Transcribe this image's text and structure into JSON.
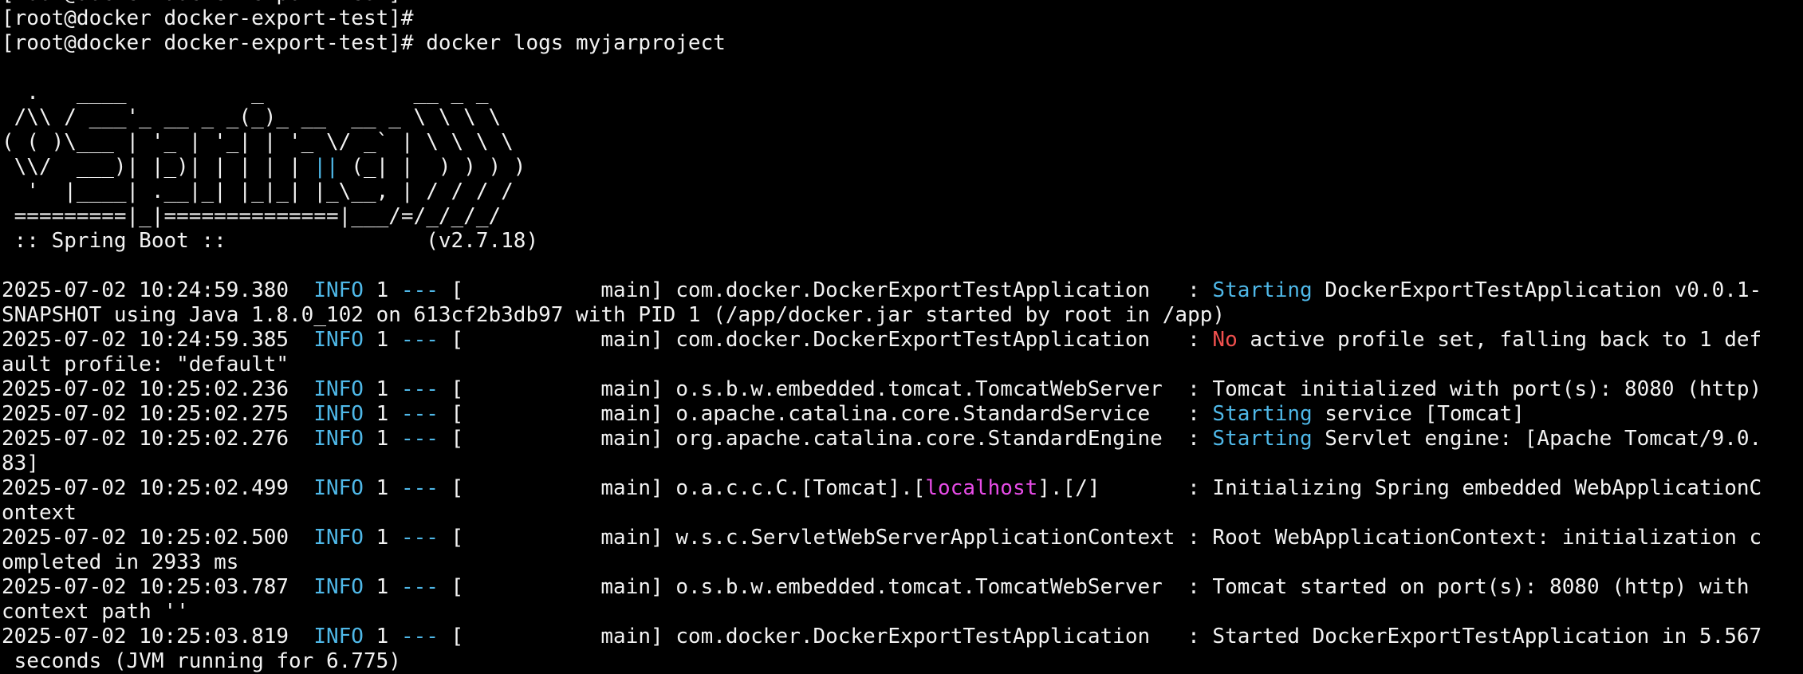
{
  "terminal": {
    "background": "#000000",
    "foreground": "#f2f2f2",
    "colors": {
      "white": "#f2f2f2",
      "blue": "#4fb8e8",
      "red": "#f0504e",
      "magenta": "#e84ce8"
    },
    "lines": [
      [
        {
          "t": "[root@docker docker-export-test]#",
          "c": "white"
        }
      ],
      [
        {
          "t": "[root@docker docker-export-test]#",
          "c": "white"
        }
      ],
      [
        {
          "t": "[root@docker docker-export-test]# docker logs myjarproject",
          "c": "white"
        }
      ],
      [
        {
          "t": "",
          "c": "white"
        }
      ],
      [
        {
          "t": "  .   ____          _            __ _ _",
          "c": "white"
        }
      ],
      [
        {
          "t": " /\\\\ / ___'_ __ _ _(_)_ __  __ _ \\ \\ \\ \\",
          "c": "white"
        }
      ],
      [
        {
          "t": "( ( )\\___ | '_ | '_| | '_ \\/ _` | \\ \\ \\ \\",
          "c": "white"
        }
      ],
      [
        {
          "t": " \\\\/  ___)| |_)| | | | | ",
          "c": "white"
        },
        {
          "t": "||",
          "c": "blue"
        },
        {
          "t": " (_| |  ) ) ) )",
          "c": "white"
        }
      ],
      [
        {
          "t": "  '  |____| .__|_| |_|_| |_\\__, | / / / /",
          "c": "white"
        }
      ],
      [
        {
          "t": " =========|_|==============|___/=/_/_/_/",
          "c": "white"
        }
      ],
      [
        {
          "t": " :: Spring Boot ::                (v2.7.18)",
          "c": "white"
        }
      ],
      [
        {
          "t": "",
          "c": "white"
        }
      ],
      [
        {
          "t": "2025-07-02 10:24:59.380  ",
          "c": "white"
        },
        {
          "t": "INFO",
          "c": "blue"
        },
        {
          "t": " 1 ",
          "c": "white"
        },
        {
          "t": "---",
          "c": "blue"
        },
        {
          "t": " [           main] com.docker.DockerExportTestApplication   : ",
          "c": "white"
        },
        {
          "t": "Starting",
          "c": "blue"
        },
        {
          "t": " DockerExportTestApplication v0.0.1-",
          "c": "white"
        }
      ],
      [
        {
          "t": "SNAPSHOT using Java 1.8.0_102 on 613cf2b3db97 with PID 1 (/app/docker.jar started by root in /app)",
          "c": "white"
        }
      ],
      [
        {
          "t": "2025-07-02 10:24:59.385  ",
          "c": "white"
        },
        {
          "t": "INFO",
          "c": "blue"
        },
        {
          "t": " 1 ",
          "c": "white"
        },
        {
          "t": "---",
          "c": "blue"
        },
        {
          "t": " [           main] com.docker.DockerExportTestApplication   : ",
          "c": "white"
        },
        {
          "t": "No",
          "c": "red"
        },
        {
          "t": " active profile set, falling back to 1 def",
          "c": "white"
        }
      ],
      [
        {
          "t": "ault profile: \"default\"",
          "c": "white"
        }
      ],
      [
        {
          "t": "2025-07-02 10:25:02.236  ",
          "c": "white"
        },
        {
          "t": "INFO",
          "c": "blue"
        },
        {
          "t": " 1 ",
          "c": "white"
        },
        {
          "t": "---",
          "c": "blue"
        },
        {
          "t": " [           main] o.s.b.w.embedded.tomcat.TomcatWebServer  : Tomcat initialized with port(s): 8080 (http)",
          "c": "white"
        }
      ],
      [
        {
          "t": "2025-07-02 10:25:02.275  ",
          "c": "white"
        },
        {
          "t": "INFO",
          "c": "blue"
        },
        {
          "t": " 1 ",
          "c": "white"
        },
        {
          "t": "---",
          "c": "blue"
        },
        {
          "t": " [           main] o.apache.catalina.core.StandardService   : ",
          "c": "white"
        },
        {
          "t": "Starting",
          "c": "blue"
        },
        {
          "t": " service [Tomcat]",
          "c": "white"
        }
      ],
      [
        {
          "t": "2025-07-02 10:25:02.276  ",
          "c": "white"
        },
        {
          "t": "INFO",
          "c": "blue"
        },
        {
          "t": " 1 ",
          "c": "white"
        },
        {
          "t": "---",
          "c": "blue"
        },
        {
          "t": " [           main] org.apache.catalina.core.StandardEngine  : ",
          "c": "white"
        },
        {
          "t": "Starting",
          "c": "blue"
        },
        {
          "t": " Servlet engine: [Apache Tomcat/9.0.",
          "c": "white"
        }
      ],
      [
        {
          "t": "83]",
          "c": "white"
        }
      ],
      [
        {
          "t": "2025-07-02 10:25:02.499  ",
          "c": "white"
        },
        {
          "t": "INFO",
          "c": "blue"
        },
        {
          "t": " 1 ",
          "c": "white"
        },
        {
          "t": "---",
          "c": "blue"
        },
        {
          "t": " [           main] o.a.c.c.C.[Tomcat].[",
          "c": "white"
        },
        {
          "t": "localhost",
          "c": "magenta"
        },
        {
          "t": "].[/]       : Initializing Spring embedded WebApplicationC",
          "c": "white"
        }
      ],
      [
        {
          "t": "ontext",
          "c": "white"
        }
      ],
      [
        {
          "t": "2025-07-02 10:25:02.500  ",
          "c": "white"
        },
        {
          "t": "INFO",
          "c": "blue"
        },
        {
          "t": " 1 ",
          "c": "white"
        },
        {
          "t": "---",
          "c": "blue"
        },
        {
          "t": " [           main] w.s.c.ServletWebServerApplicationContext : Root WebApplicationContext: initialization c",
          "c": "white"
        }
      ],
      [
        {
          "t": "ompleted in 2933 ms",
          "c": "white"
        }
      ],
      [
        {
          "t": "2025-07-02 10:25:03.787  ",
          "c": "white"
        },
        {
          "t": "INFO",
          "c": "blue"
        },
        {
          "t": " 1 ",
          "c": "white"
        },
        {
          "t": "---",
          "c": "blue"
        },
        {
          "t": " [           main] o.s.b.w.embedded.tomcat.TomcatWebServer  : Tomcat started on port(s): 8080 (http) with ",
          "c": "white"
        }
      ],
      [
        {
          "t": "context path ''",
          "c": "white"
        }
      ],
      [
        {
          "t": "2025-07-02 10:25:03.819  ",
          "c": "white"
        },
        {
          "t": "INFO",
          "c": "blue"
        },
        {
          "t": " 1 ",
          "c": "white"
        },
        {
          "t": "---",
          "c": "blue"
        },
        {
          "t": " [           main] com.docker.DockerExportTestApplication   : Started DockerExportTestApplication in 5.567",
          "c": "white"
        }
      ],
      [
        {
          "t": " seconds (JVM running for 6.775)",
          "c": "white"
        }
      ]
    ]
  }
}
